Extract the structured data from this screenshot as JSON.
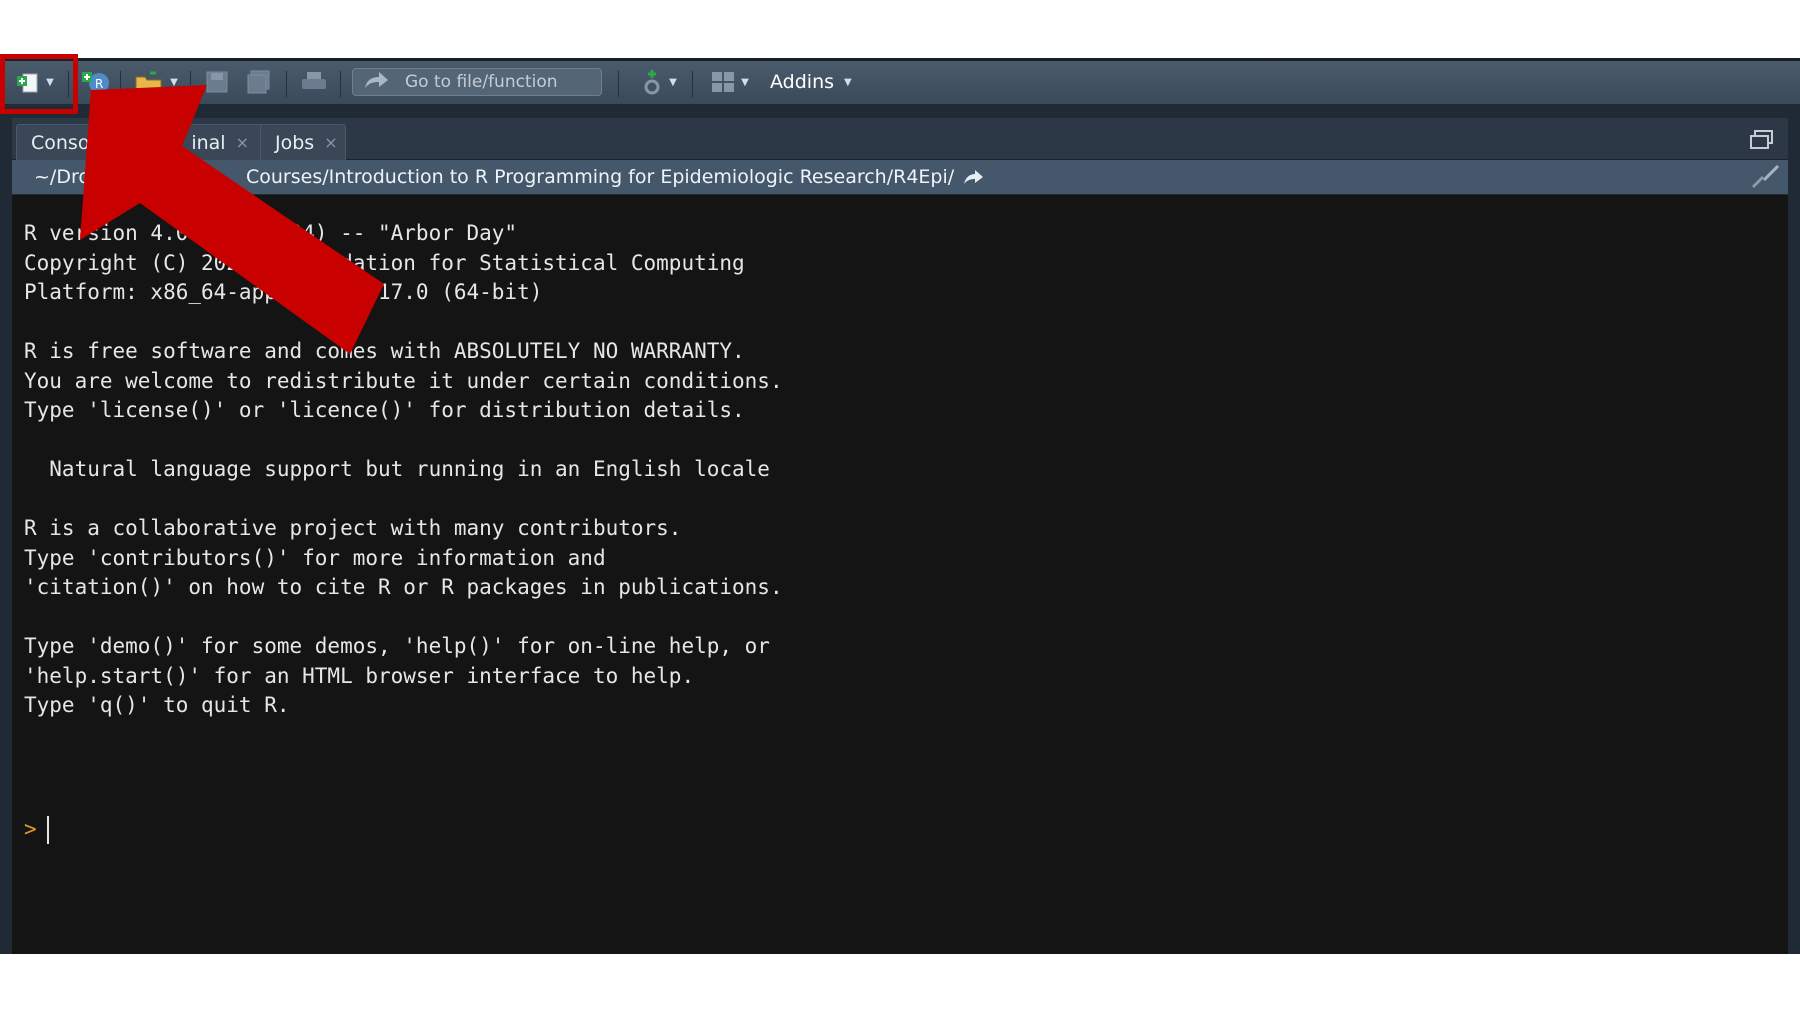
{
  "colors": {
    "accent_red": "#c80000",
    "prompt": "#e39a2a",
    "toolbar": "#44566a",
    "console_bg": "#141414"
  },
  "toolbar": {
    "goto_placeholder": "Go to file/function",
    "addins_label": "Addins",
    "icons": [
      "new-file-icon",
      "new-project-icon",
      "open-folder-icon",
      "save-icon",
      "save-all-icon",
      "print-icon",
      "goto-arrow-icon",
      "git-icon",
      "grid-layout-icon"
    ]
  },
  "tabs": [
    {
      "label": "Conso",
      "close": ""
    },
    {
      "label": "inal",
      "close": "×"
    },
    {
      "label": "Jobs",
      "close": "×"
    }
  ],
  "path": {
    "text_left": "~/Dro",
    "text_right": "Courses/Introduction to R Programming for Epidemiologic Research/R4Epi/"
  },
  "console": {
    "lines": [
      "R version 4.0        24) -- \"Arbor Day\"",
      "Copyright (C) 202        dation for Statistical Computing",
      "Platform: x86_64-app        17.0 (64-bit)",
      "",
      "R is free software and comes with ABSOLUTELY NO WARRANTY.",
      "You are welcome to redistribute it under certain conditions.",
      "Type 'license()' or 'licence()' for distribution details.",
      "",
      "  Natural language support but running in an English locale",
      "",
      "R is a collaborative project with many contributors.",
      "Type 'contributors()' for more information and",
      "'citation()' on how to cite R or R packages in publications.",
      "",
      "Type 'demo()' for some demos, 'help()' for on-line help, or",
      "'help.start()' for an HTML browser interface to help.",
      "Type 'q()' to quit R."
    ],
    "prompt": ">"
  }
}
